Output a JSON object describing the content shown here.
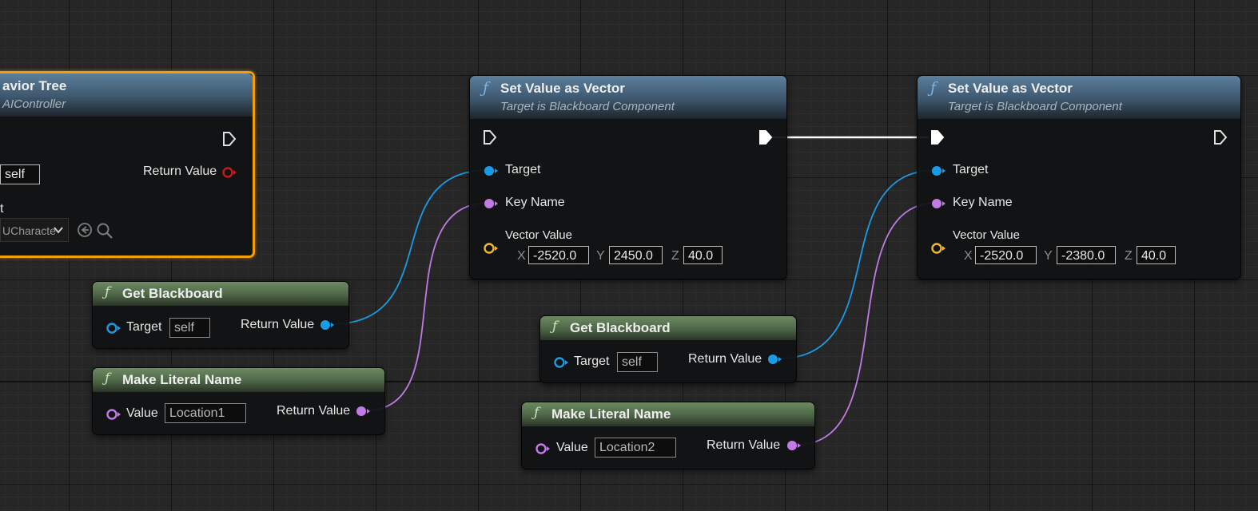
{
  "nodes": {
    "run_behavior_tree": {
      "title": "avior Tree",
      "subtitle": "AIController",
      "return_label": "Return Value",
      "target_value": "self",
      "asset_label": "t",
      "asset_value": "UCharacte"
    },
    "set_vector_1": {
      "title": "Set Value as Vector",
      "subtitle": "Target is Blackboard Component",
      "target_label": "Target",
      "key_label": "Key Name",
      "vector_label": "Vector Value",
      "x_label": "X",
      "x": "-2520.0",
      "y_label": "Y",
      "y": "2450.0",
      "z_label": "Z",
      "z": "40.0"
    },
    "set_vector_2": {
      "title": "Set Value as Vector",
      "subtitle": "Target is Blackboard Component",
      "target_label": "Target",
      "key_label": "Key Name",
      "vector_label": "Vector Value",
      "x_label": "X",
      "x": "-2520.0",
      "y_label": "Y",
      "y": "-2380.0",
      "z_label": "Z",
      "z": "40.0"
    },
    "get_blackboard_1": {
      "title": "Get Blackboard",
      "target_label": "Target",
      "target_value": "self",
      "return_label": "Return Value"
    },
    "get_blackboard_2": {
      "title": "Get Blackboard",
      "target_label": "Target",
      "target_value": "self",
      "return_label": "Return Value"
    },
    "make_literal_name_1": {
      "title": "Make Literal Name",
      "value_label": "Value",
      "value": "Location1",
      "return_label": "Return Value"
    },
    "make_literal_name_2": {
      "title": "Make Literal Name",
      "value_label": "Value",
      "value": "Location2",
      "return_label": "Return Value"
    }
  },
  "icons": {
    "function": "ƒ",
    "exec_pin": "exec-pin-icon",
    "object_pin": "object-pin-icon",
    "name_pin": "name-pin-icon",
    "vector_pin": "vector-pin-icon",
    "dropdown": "chevron-down-icon",
    "browse": "browse-arrow-icon",
    "search": "search-icon"
  },
  "colors": {
    "object_pin": "#1a9be6",
    "name_pin": "#c27ae6",
    "vector_pin": "#f0b829",
    "exec_wire": "#ffffff",
    "selection": "#f29d0a",
    "return_pin_red": "#c21b1b"
  }
}
